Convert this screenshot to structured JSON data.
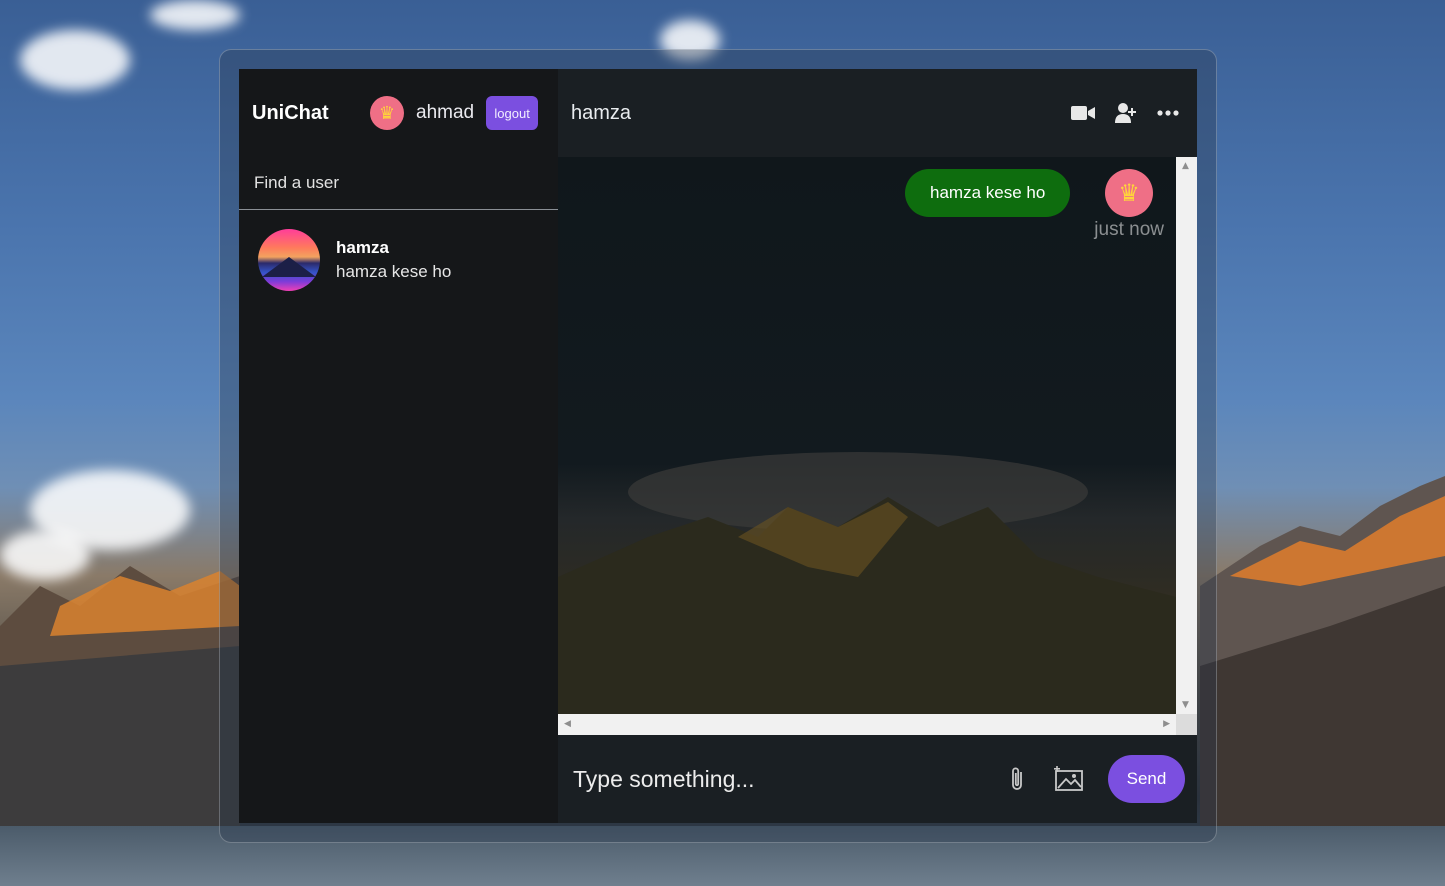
{
  "app": {
    "brand": "UniChat",
    "current_user": {
      "name": "ahmad",
      "avatar_icon": "crown-icon"
    },
    "logout_label": "logout"
  },
  "sidebar": {
    "search_placeholder": "Find a user",
    "chats": [
      {
        "name": "hamza",
        "last_message": "hamza kese ho",
        "avatar": "mountain-sunset-avatar"
      }
    ]
  },
  "conversation": {
    "contact_name": "hamza",
    "header_icons": [
      "video-camera-icon",
      "add-user-icon",
      "more-options-icon"
    ],
    "messages": [
      {
        "text": "hamza kese ho",
        "time": "just now",
        "owner": true,
        "avatar_icon": "crown-icon"
      }
    ]
  },
  "composer": {
    "placeholder": "Type something...",
    "send_label": "Send"
  },
  "colors": {
    "accent": "#7b4fe0",
    "bubble": "#0e6d0e",
    "sidebar_bg": "#151719",
    "header_bg": "#1a1f23"
  }
}
